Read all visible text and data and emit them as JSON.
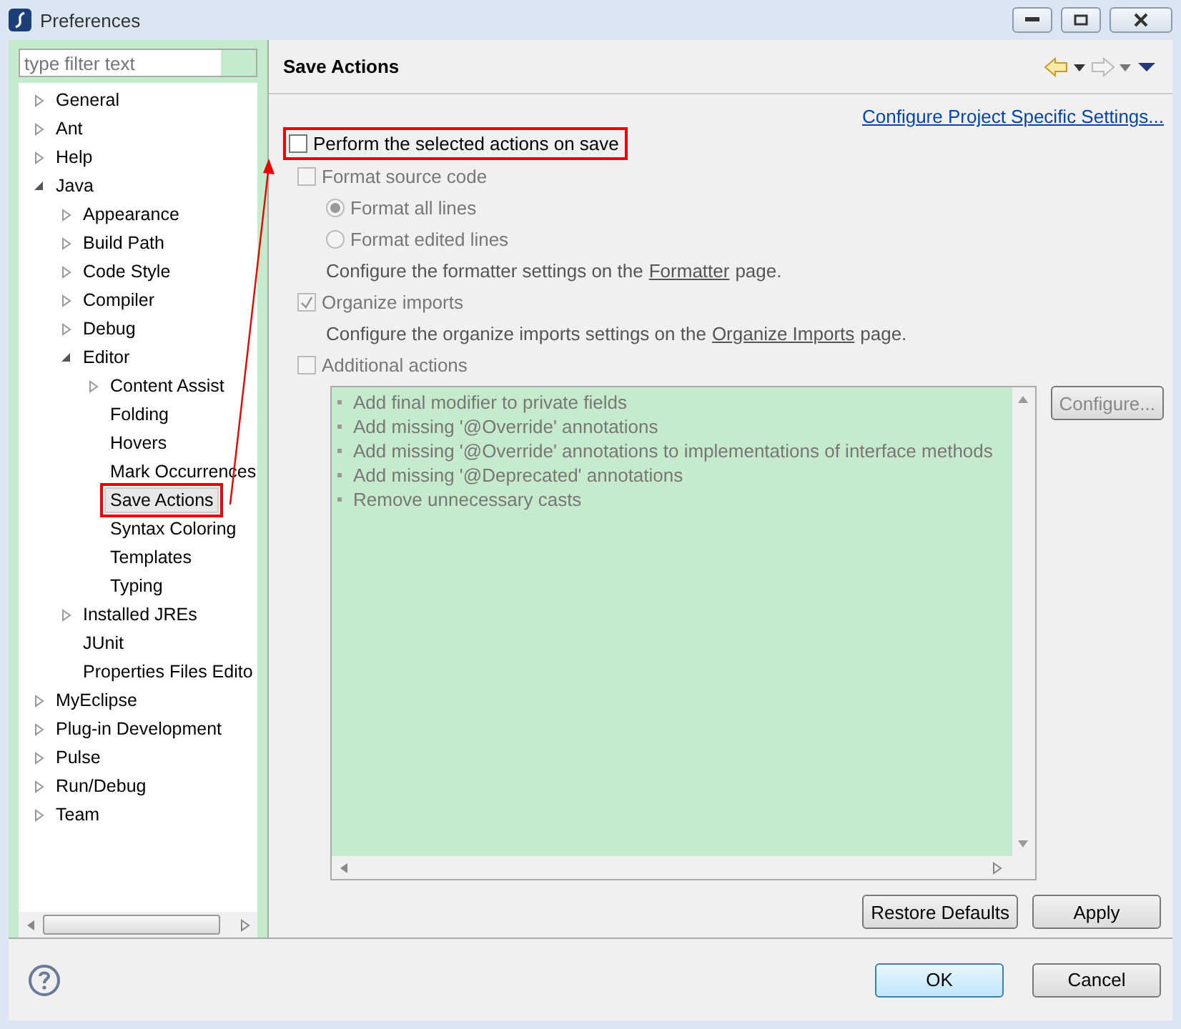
{
  "window": {
    "title": "Preferences"
  },
  "filter": {
    "placeholder": "type filter text"
  },
  "tree": [
    {
      "label": "General",
      "expanded": false,
      "selected": false
    },
    {
      "label": "Ant",
      "expanded": false,
      "selected": false
    },
    {
      "label": "Help",
      "expanded": false,
      "selected": false
    },
    {
      "label": "Java",
      "expanded": true,
      "selected": false,
      "children": [
        {
          "label": "Appearance",
          "expanded": false,
          "selected": false
        },
        {
          "label": "Build Path",
          "expanded": false,
          "selected": false
        },
        {
          "label": "Code Style",
          "expanded": false,
          "selected": false
        },
        {
          "label": "Compiler",
          "expanded": false,
          "selected": false
        },
        {
          "label": "Debug",
          "expanded": false,
          "selected": false
        },
        {
          "label": "Editor",
          "expanded": true,
          "selected": false,
          "children": [
            {
              "label": "Content Assist",
              "expanded": false,
              "selected": false
            },
            {
              "label": "Folding",
              "selected": false
            },
            {
              "label": "Hovers",
              "selected": false
            },
            {
              "label": "Mark Occurrences",
              "selected": false
            },
            {
              "label": "Save Actions",
              "selected": true,
              "highlighted": true
            },
            {
              "label": "Syntax Coloring",
              "selected": false
            },
            {
              "label": "Templates",
              "selected": false
            },
            {
              "label": "Typing",
              "selected": false
            }
          ]
        },
        {
          "label": "Installed JREs",
          "expanded": false,
          "selected": false
        },
        {
          "label": "JUnit",
          "selected": false
        },
        {
          "label": "Properties Files Edito",
          "selected": false
        }
      ]
    },
    {
      "label": "MyEclipse",
      "expanded": false,
      "selected": false
    },
    {
      "label": "Plug-in Development",
      "expanded": false,
      "selected": false
    },
    {
      "label": "Pulse",
      "expanded": false,
      "selected": false
    },
    {
      "label": "Run/Debug",
      "expanded": false,
      "selected": false
    },
    {
      "label": "Team",
      "expanded": false,
      "selected": false
    }
  ],
  "page": {
    "title": "Save Actions",
    "link": "Configure Project Specific Settings..."
  },
  "master": {
    "label": "Perform the selected actions on save",
    "checked": false,
    "highlighted": true
  },
  "options": [
    {
      "kind": "checkbox",
      "label": "Format source code",
      "checked": false,
      "disabled": true
    },
    {
      "kind": "radio",
      "label": "Format all lines",
      "selected": true,
      "disabled": true
    },
    {
      "kind": "radio",
      "label": "Format edited lines",
      "selected": false,
      "disabled": true
    },
    {
      "kind": "note",
      "before": "Configure the formatter settings on the",
      "link": "Formatter",
      "after": "page."
    },
    {
      "kind": "checkbox",
      "label": "Organize imports",
      "checked": true,
      "disabled": true
    },
    {
      "kind": "note",
      "before": "Configure the organize imports settings on the",
      "link": "Organize Imports",
      "after": "page."
    },
    {
      "kind": "checkbox",
      "label": "Additional actions",
      "checked": false,
      "disabled": true
    }
  ],
  "actions": {
    "items": [
      "Add final modifier to private fields",
      "Add missing '@Override' annotations",
      "Add missing '@Override' annotations to implementations of interface methods",
      "Add missing '@Deprecated' annotations",
      "Remove unnecessary casts"
    ],
    "configure": {
      "label": "Configure...",
      "disabled": true
    }
  },
  "page_buttons": [
    "Restore Defaults",
    "Apply"
  ],
  "dialog_buttons": [
    {
      "label": "OK",
      "default": true
    },
    {
      "label": "Cancel",
      "default": false
    }
  ]
}
